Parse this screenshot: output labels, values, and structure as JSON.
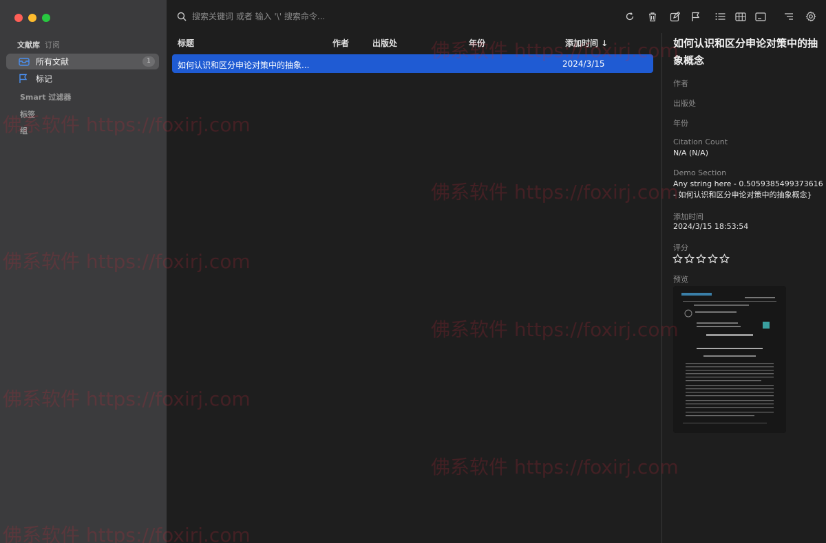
{
  "window": {
    "traffic_lights": [
      "close",
      "minimize",
      "zoom"
    ]
  },
  "sidebar": {
    "tabs": [
      "文献库",
      "订阅"
    ],
    "items": [
      {
        "label": "所有文献",
        "icon": "tray-icon",
        "badge": "1",
        "selected": true
      },
      {
        "label": "标记",
        "icon": "flag-icon"
      }
    ],
    "sections": [
      "Smart 过滤器",
      "标签",
      "组"
    ]
  },
  "toolbar": {
    "search_placeholder": "搜索关键词 或者 输入 '\\' 搜索命令...",
    "tools": [
      "reload-icon",
      "trash-icon",
      "edit-icon",
      "flag-icon",
      "list-view-icon",
      "table-view-icon",
      "card-view-icon",
      "sort-icon",
      "settings-icon"
    ]
  },
  "list": {
    "columns": [
      "标题",
      "作者",
      "出版处",
      "年份",
      "添加时间 ↓"
    ],
    "rows": [
      {
        "title": "如何认识和区分申论对策中的抽象...",
        "author": "",
        "publisher": "",
        "year": "",
        "added": "2024/3/15"
      }
    ]
  },
  "detail": {
    "title": "如何认识和区分申论对策中的抽象概念",
    "author_label": "作者",
    "publisher_label": "出版处",
    "year_label": "年份",
    "citation_label": "Citation Count",
    "citation_value": "N/A (N/A)",
    "demo_label": "Demo Section",
    "demo_value_1": "Any string here - 0.5059385499373616",
    "demo_value_2": "- 如何认识和区分申论对策中的抽象概念}",
    "added_label": "添加时间",
    "added_value": "2024/3/15 18:53:54",
    "rating_label": "评分",
    "rating": 0,
    "rating_max": 5,
    "preview_label": "预览"
  },
  "watermark": "佛系软件 https://foxirj.com",
  "colors": {
    "sidebar_bg": "#3b3b3d",
    "main_bg": "#1e1e1e",
    "selection": "#1f5bd3",
    "accent_icon": "#4a8ff0"
  }
}
